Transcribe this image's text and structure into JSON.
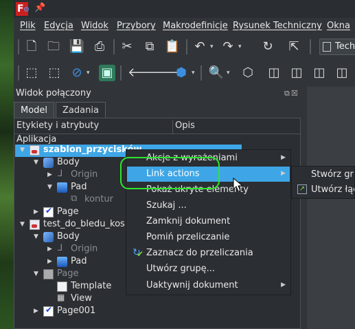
{
  "menubar": {
    "items": [
      "Plik",
      "Edycja",
      "Widok",
      "Przybory",
      "Makrodefinicje",
      "Rysunek Techniczny",
      "Okna"
    ]
  },
  "toolbar": {
    "workbench_selector": "Techn"
  },
  "panel": {
    "title": "Widok połączony",
    "tabs": [
      "Model",
      "Zadania"
    ],
    "columns": [
      "Etykiety i atrybuty",
      "Opis"
    ],
    "root_label": "Aplikacja"
  },
  "tree": [
    {
      "label": "szablon_przycisków",
      "depth": 0,
      "arrow": "down",
      "icon": "document-icon",
      "selected": true
    },
    {
      "label": "Body",
      "depth": 1,
      "arrow": "down",
      "icon": "body-icon"
    },
    {
      "label": "Origin",
      "depth": 2,
      "arrow": "right",
      "icon": "origin-icon",
      "gray": true
    },
    {
      "label": "Pad",
      "depth": 2,
      "arrow": "down",
      "icon": "pad-icon"
    },
    {
      "label": "kontur",
      "depth": 3,
      "arrow": "",
      "icon": "sketch-icon",
      "gray": true
    },
    {
      "label": "Page",
      "depth": 1,
      "arrow": "right",
      "icon": "page-icon"
    },
    {
      "label": "test_do_bledu_kosm",
      "depth": 0,
      "arrow": "down",
      "icon": "document-icon"
    },
    {
      "label": "Body",
      "depth": 1,
      "arrow": "down",
      "icon": "body-icon"
    },
    {
      "label": "Origin",
      "depth": 2,
      "arrow": "right",
      "icon": "origin-icon",
      "gray": true
    },
    {
      "label": "Pad",
      "depth": 2,
      "arrow": "right",
      "icon": "pad-icon"
    },
    {
      "label": "Page",
      "depth": 1,
      "arrow": "down",
      "icon": "page-blank-icon",
      "gray": true
    },
    {
      "label": "Template",
      "depth": 2,
      "arrow": "",
      "icon": "template-icon"
    },
    {
      "label": "View",
      "depth": 2,
      "arrow": "",
      "icon": "view-icon"
    },
    {
      "label": "Page001",
      "depth": 1,
      "arrow": "right",
      "icon": "page-icon"
    }
  ],
  "context_menu": {
    "items": [
      {
        "label": "Akcje z wyrażeniami",
        "submenu": true
      },
      {
        "label": "Link actions",
        "submenu": true,
        "highlighted": true
      },
      {
        "label": "Pokaż ukryte elementy",
        "submenu": false
      },
      {
        "label": "Szukaj ...",
        "submenu": false
      },
      {
        "label": "Zamknij dokument",
        "submenu": false
      },
      {
        "label": "Pomiń przeliczanie",
        "submenu": false
      },
      {
        "label": "Zaznacz do przeliczania",
        "submenu": false,
        "icon": "recompute-icon"
      },
      {
        "label": "Utwórz grupę...",
        "submenu": false
      },
      {
        "label": "Uaktywnij dokument",
        "submenu": true
      }
    ]
  },
  "submenu": {
    "items": [
      {
        "label": "Stwórz grupę"
      },
      {
        "label": "Utwórz łącze",
        "icon": "link-icon"
      }
    ]
  },
  "colors": {
    "selection": "#3ea6e6",
    "highlight_ring": "#2ee62e",
    "background": "#313539"
  }
}
